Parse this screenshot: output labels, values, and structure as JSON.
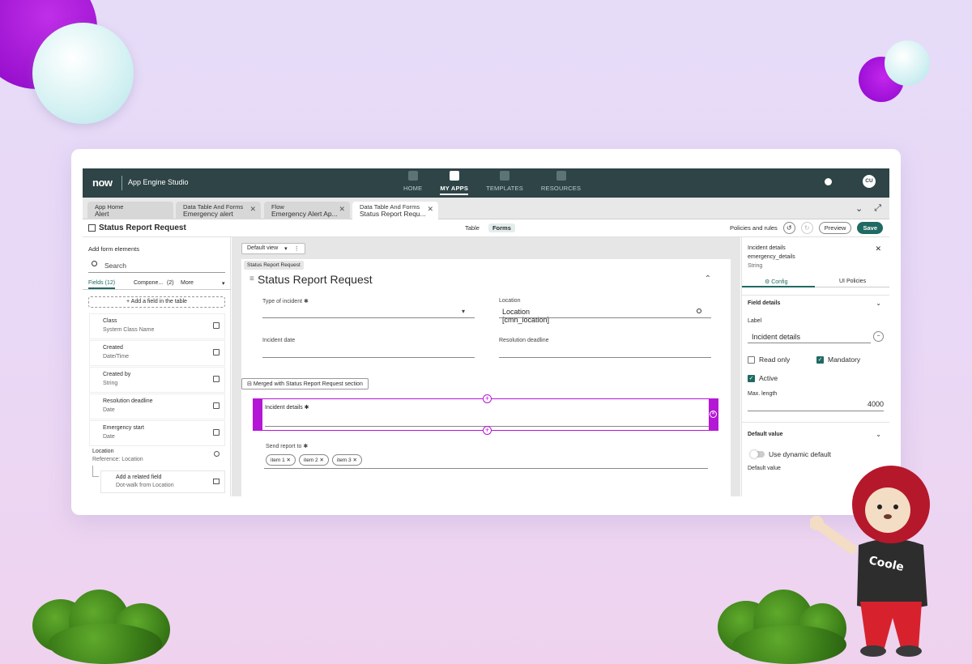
{
  "topbar": {
    "logo": "now",
    "studio": "App Engine Studio",
    "nav": [
      "HOME",
      "MY APPS",
      "TEMPLATES",
      "RESOURCES"
    ],
    "avatar": "CU"
  },
  "tabs": [
    {
      "title": "App Home",
      "sub": "Alert"
    },
    {
      "title": "Data Table And Forms",
      "sub": "Emergency alert"
    },
    {
      "title": "Flow",
      "sub": "Emergency Alert Ap..."
    },
    {
      "title": "Data Table And Forms",
      "sub": "Status Report Requ..."
    }
  ],
  "header": {
    "title": "Status Report Request",
    "table": "Table",
    "forms": "Forms",
    "policies": "Policies and rules",
    "preview": "Preview",
    "save": "Save"
  },
  "left": {
    "title": "Add form elements",
    "search_placeholder": "Search",
    "tab_fields": "Fields (12)",
    "tab_components": "Compone...",
    "tab_components_count": "(2)",
    "tab_more": "More",
    "add_field": "+ Add a field in the table",
    "fields": [
      {
        "name": "Class",
        "type": "System Class Name"
      },
      {
        "name": "Created",
        "type": "Date/Time"
      },
      {
        "name": "Created by",
        "type": "String"
      },
      {
        "name": "Resolution deadline",
        "type": "Date"
      },
      {
        "name": "Emergency start",
        "type": "Date"
      }
    ],
    "location_name": "Location",
    "location_ref": "Reference:",
    "location_ref_value": "Location",
    "related_name": "Add a related field",
    "related_sub": "Dot-walk from Location"
  },
  "canvas": {
    "view": "Default view",
    "section_tag": "Status Report Request",
    "form_title": "Status Report Request",
    "type_label": "Type of incident",
    "location_label": "Location",
    "location_value": "Location [cmn_location]",
    "incident_date_label": "Incident date",
    "resolution_label": "Resolution deadline",
    "merged": "Merged with Status Report Request section",
    "incident_details_label": "Incident details",
    "send_report_label": "Send report to",
    "chips": [
      "item 1",
      "item 2",
      "item 3"
    ]
  },
  "right": {
    "title": "Incident details",
    "name": "emergency_details",
    "type": "String",
    "tab_config": "Config",
    "tab_ui": "UI Policies",
    "field_details": "Field details",
    "label_caption": "Label",
    "label_value": "Incident details",
    "read_only": "Read only",
    "mandatory": "Mandatory",
    "active": "Active",
    "max_length_caption": "Max. length",
    "max_length_value": "4000",
    "default_value_header": "Default value",
    "use_dynamic": "Use dynamic default",
    "default_value_caption": "Default value"
  }
}
